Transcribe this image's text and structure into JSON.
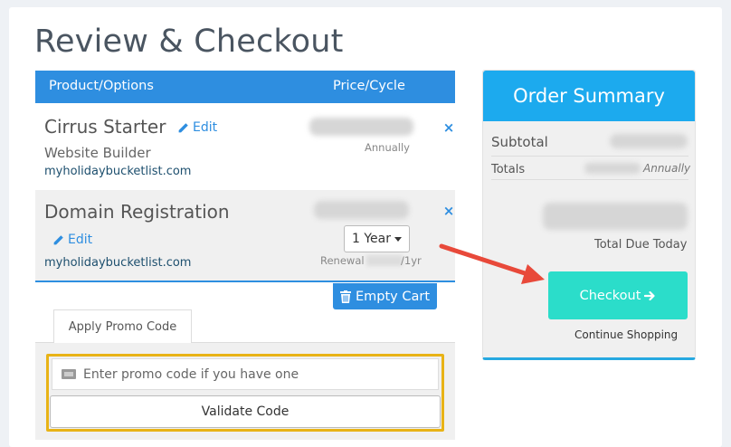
{
  "page": {
    "title": "Review & Checkout"
  },
  "cart": {
    "headers": {
      "product": "Product/Options",
      "price": "Price/Cycle"
    },
    "items": [
      {
        "name": "Cirrus Starter",
        "edit_label": "Edit",
        "subtitle": "Website Builder",
        "domain": "myholidaybucketlist.com",
        "cycle": "Annually"
      },
      {
        "name": "Domain Registration",
        "edit_label": "Edit",
        "domain": "myholidaybucketlist.com",
        "term": "1 Year",
        "renewal_label": "Renewal",
        "renewal_period": "/1yr"
      }
    ],
    "remove_icon": "×",
    "empty_cart_label": "Empty Cart"
  },
  "promo": {
    "tab_label": "Apply Promo Code",
    "input_placeholder": "Enter promo code if you have one",
    "validate_label": "Validate Code"
  },
  "summary": {
    "title": "Order Summary",
    "subtotal_label": "Subtotal",
    "totals_label": "Totals",
    "totals_cycle": "Annually",
    "total_due_label": "Total Due Today",
    "checkout_label": "Checkout",
    "continue_label": "Continue Shopping"
  },
  "colors": {
    "primary": "#2e8ee0",
    "summary_header": "#1caaee",
    "checkout": "#2bddca",
    "highlight": "#e8b316",
    "arrow": "#e8493a"
  }
}
